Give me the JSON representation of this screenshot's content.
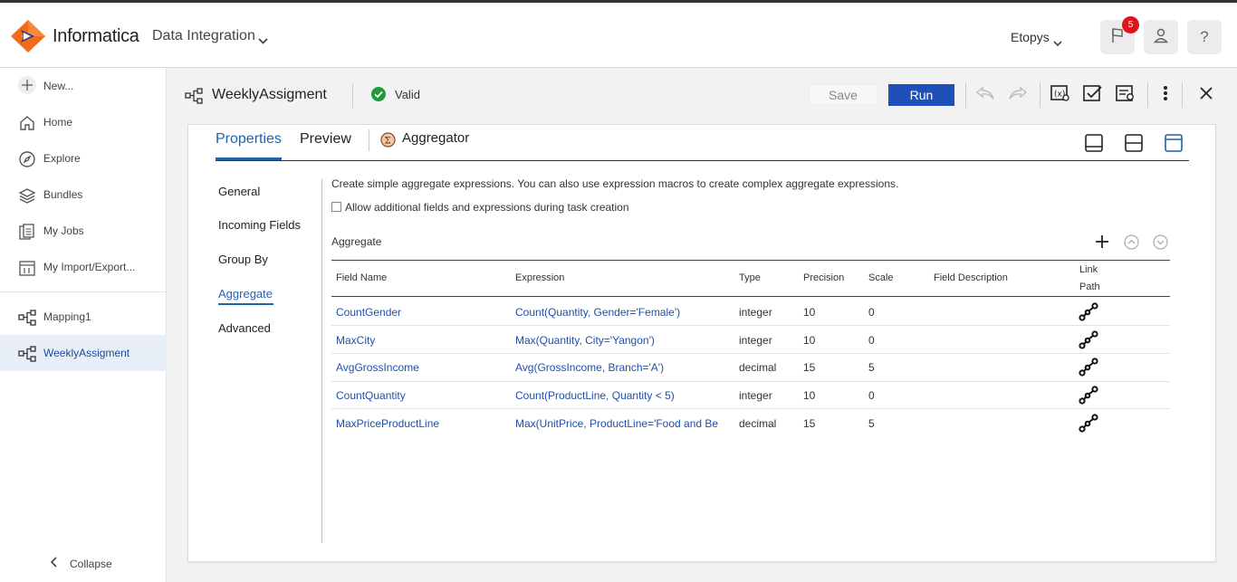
{
  "topbar": {
    "brand": "Informatica",
    "product": "Data Integration",
    "org": "Etopys",
    "notification_count": "5",
    "help_label": "?"
  },
  "sidebar": {
    "items": [
      {
        "label": "New...",
        "icon": "plus-icon"
      },
      {
        "label": "Home",
        "icon": "home-icon"
      },
      {
        "label": "Explore",
        "icon": "explore-icon"
      },
      {
        "label": "Bundles",
        "icon": "bundles-icon"
      },
      {
        "label": "My Jobs",
        "icon": "jobs-icon"
      },
      {
        "label": "My Import/Export...",
        "icon": "import-export-icon"
      },
      {
        "label": "Mapping1",
        "icon": "mapping-icon"
      },
      {
        "label": "WeeklyAssigment",
        "icon": "mapping-icon"
      }
    ],
    "collapse_label": "Collapse"
  },
  "asset_header": {
    "name": "WeeklyAssigment",
    "status": "Valid",
    "save_label": "Save",
    "run_label": "Run"
  },
  "panel": {
    "tabs": [
      "Properties",
      "Preview"
    ],
    "transformation_name": "Aggregator",
    "side_nav": [
      "General",
      "Incoming Fields",
      "Group By",
      "Aggregate",
      "Advanced"
    ],
    "description": "Create simple aggregate expressions. You can also use expression macros to create complex aggregate expressions.",
    "checkbox_label": "Allow additional fields and expressions during task creation",
    "section_title": "Aggregate",
    "columns": [
      "Field Name",
      "Expression",
      "Type",
      "Precision",
      "Scale",
      "Field Description",
      "Link",
      "Path"
    ],
    "rows": [
      {
        "field": "CountGender",
        "expression": "Count(Quantity, Gender='Female')",
        "type": "integer",
        "precision": "10",
        "scale": "0"
      },
      {
        "field": "MaxCity",
        "expression": "Max(Quantity, City='Yangon')",
        "type": "integer",
        "precision": "10",
        "scale": "0"
      },
      {
        "field": "AvgGrossIncome",
        "expression": "Avg(GrossIncome, Branch='A')",
        "type": "decimal",
        "precision": "15",
        "scale": "5"
      },
      {
        "field": "CountQuantity",
        "expression": "Count(ProductLine, Quantity < 5)",
        "type": "integer",
        "precision": "10",
        "scale": "0"
      },
      {
        "field": "MaxPriceProductLine",
        "expression": "Max(UnitPrice, ProductLine='Food and Be",
        "type": "decimal",
        "precision": "15",
        "scale": "5"
      }
    ]
  },
  "colors": {
    "accent": "#1f62b0",
    "run_button": "#1f4fb8",
    "valid_green": "#1e9b3b",
    "badge_red": "#e0121b",
    "logo_orange": "#f26b1d"
  }
}
